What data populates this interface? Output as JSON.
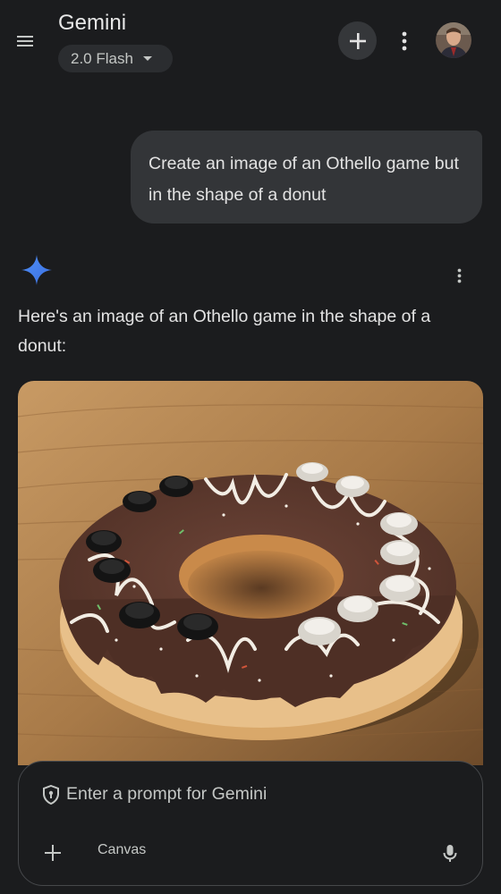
{
  "header": {
    "title": "Gemini",
    "model_label": "2.0 Flash",
    "icons": [
      "menu-icon",
      "caret-down-icon",
      "plus-icon",
      "more-vert-icon",
      "avatar"
    ]
  },
  "conversation": {
    "user_message": "Create an image of an Othello game but in the shape of a donut",
    "response_text": "Here's an image of an Othello game in the shape of a donut:"
  },
  "composer": {
    "placeholder": "Enter a prompt for Gemini",
    "canvas_label": "Canvas",
    "icons": [
      "shield-icon",
      "plus-icon",
      "mic-icon"
    ]
  },
  "colors": {
    "background": "#1b1c1e",
    "bubble": "#333538",
    "chip": "#2b2d30",
    "spark_blue": "#4f8ff7"
  }
}
